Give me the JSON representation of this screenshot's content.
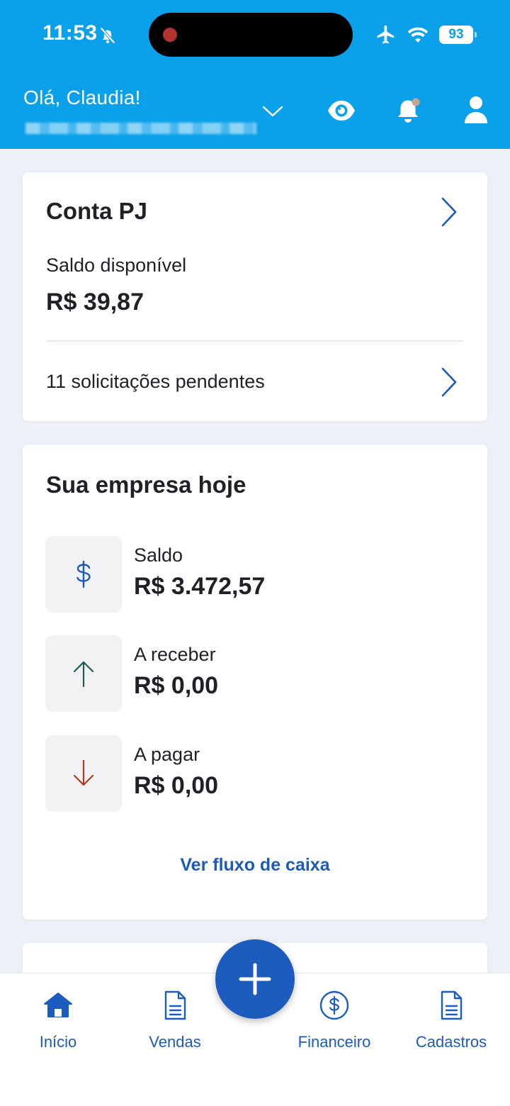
{
  "status_bar": {
    "time": "11:53",
    "battery": "93"
  },
  "header": {
    "greeting": "Olá, Claudia!"
  },
  "conta_pj": {
    "title": "Conta PJ",
    "balance_label": "Saldo disponível",
    "balance_value": "R$ 39,87",
    "pending": "11 solicitações pendentes"
  },
  "empresa": {
    "title": "Sua empresa hoje",
    "metrics": [
      {
        "label": "Saldo",
        "value": "R$ 3.472,57",
        "icon": "dollar-icon"
      },
      {
        "label": "A receber",
        "value": "R$ 0,00",
        "icon": "arrow-up-icon"
      },
      {
        "label": "A pagar",
        "value": "R$ 0,00",
        "icon": "arrow-down-icon"
      }
    ],
    "link": "Ver fluxo de caixa"
  },
  "nav": {
    "items": [
      {
        "label": "Início",
        "icon": "home-icon"
      },
      {
        "label": "Vendas",
        "icon": "document-icon"
      },
      {
        "label": "Financeiro",
        "icon": "dollar-circle-icon"
      },
      {
        "label": "Cadastros",
        "icon": "document-icon"
      }
    ]
  },
  "colors": {
    "header": "#0aa1ea",
    "primary": "#1d5cbf",
    "incoming": "#1e5a50",
    "outgoing": "#b23a1f"
  }
}
